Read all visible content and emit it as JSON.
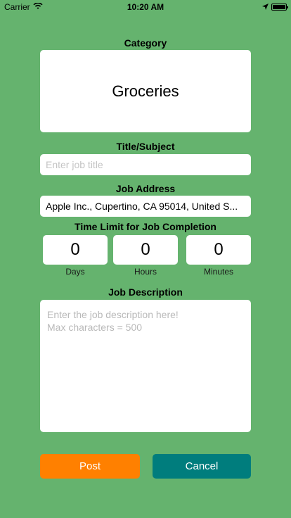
{
  "status_bar": {
    "carrier": "Carrier",
    "time": "10:20 AM",
    "icons": [
      "wifi-icon",
      "location-arrow-icon",
      "battery-icon"
    ]
  },
  "category": {
    "label": "Category",
    "value": "Groceries"
  },
  "title_field": {
    "label": "Title/Subject",
    "placeholder": "Enter job title",
    "value": ""
  },
  "address_field": {
    "label": "Job Address",
    "value": "Apple Inc., Cupertino, CA  95014, United S..."
  },
  "time_limit": {
    "label": "Time Limit for Job Completion",
    "days": {
      "value": "0",
      "label": "Days"
    },
    "hours": {
      "value": "0",
      "label": "Hours"
    },
    "minutes": {
      "value": "0",
      "label": "Minutes"
    }
  },
  "description": {
    "label": "Job Description",
    "placeholder": "Enter the job description here!\nMax characters = 500"
  },
  "actions": {
    "post_label": "Post",
    "cancel_label": "Cancel"
  },
  "colors": {
    "background": "#65b36e",
    "post": "#ff8000",
    "cancel": "#007d7d"
  }
}
